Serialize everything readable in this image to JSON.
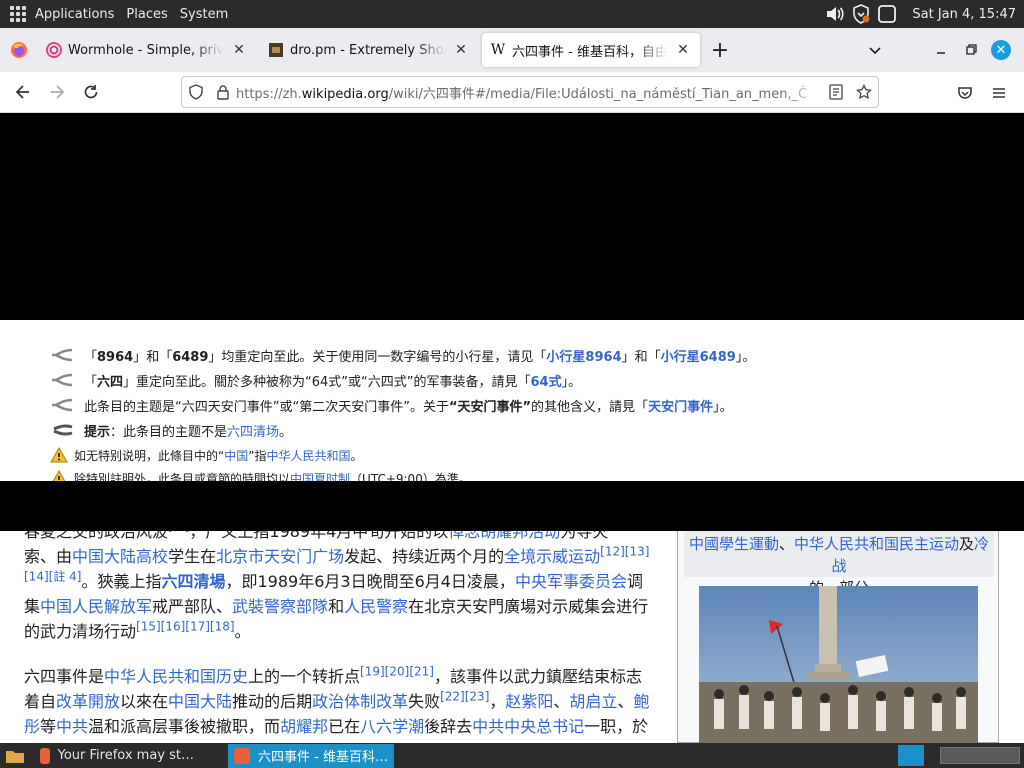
{
  "panel": {
    "applications": "Applications",
    "places": "Places",
    "system": "System",
    "clock": "Sat Jan  4, 15:47"
  },
  "tabs": [
    {
      "title": "Wormhole - Simple, private",
      "favicon": "wormhole-icon"
    },
    {
      "title": "dro.pm - Extremely Short Li",
      "favicon": "dropm-icon"
    },
    {
      "title": "六四事件 - 维基百科，自由的",
      "favicon": "wikipedia-icon",
      "active": true
    }
  ],
  "urlbar": {
    "prefix": "https://zh.",
    "host": "wikipedia.org",
    "path": "/wiki/六四事件#/media/File:Události_na_náměstí_Tian_an_men,_Č"
  },
  "notices": [
    {
      "icon": "redirect-icon",
      "parts": [
        {
          "t": "「"
        },
        {
          "t": "8964",
          "b": true
        },
        {
          "t": "」和「"
        },
        {
          "t": "6489",
          "b": true
        },
        {
          "t": "」均重定向至此。关于使用同一数字编号的小行星，请见「"
        },
        {
          "t": "小行星8964",
          "link": true,
          "b": true
        },
        {
          "t": "」和「"
        },
        {
          "t": "小行星6489",
          "link": true,
          "b": true
        },
        {
          "t": "」。"
        }
      ]
    },
    {
      "icon": "redirect-icon",
      "parts": [
        {
          "t": "「"
        },
        {
          "t": "六四",
          "b": true
        },
        {
          "t": "」重定向至此。關於多种被称为“64式”或“六四式”的军事装备，請見「"
        },
        {
          "t": "64式",
          "link": true,
          "b": true
        },
        {
          "t": "」。"
        }
      ]
    },
    {
      "icon": "redirect-icon",
      "parts": [
        {
          "t": "此条目的主题是“六四天安门事件”或“第二次天安门事件”。关于"
        },
        {
          "t": "“天安门事件”",
          "b": true
        },
        {
          "t": "的其他含义，請見「"
        },
        {
          "t": "天安门事件",
          "link": true,
          "b": true
        },
        {
          "t": "」。"
        }
      ]
    },
    {
      "icon": "hint-icon",
      "parts": [
        {
          "t": "提示",
          "b": true
        },
        {
          "t": "：此条目的主题不是"
        },
        {
          "t": "六四清场",
          "link": true
        },
        {
          "t": "。"
        }
      ]
    },
    {
      "icon": "warning-icon",
      "parts": [
        {
          "t": "如无特别说明，此條目中的“"
        },
        {
          "t": "中国",
          "link": true
        },
        {
          "t": "”指"
        },
        {
          "t": "中华人民共和国",
          "link": true
        },
        {
          "t": "。"
        }
      ]
    },
    {
      "icon": "warning-icon",
      "parts": [
        {
          "t": "除特別註明外，此条目或章節的時間均以"
        },
        {
          "t": "中国夏时制",
          "link": true
        },
        {
          "t": "（UTC+9:00）為準。"
        }
      ]
    }
  ],
  "article": {
    "para1": [
      {
        "t": "春夏之交的政治风波"
      },
      {
        "t": "[…]",
        "sup": true
      },
      {
        "t": "，广义上指1989年4月中旬开始的以"
      },
      {
        "t": "悼念胡耀邦活动",
        "link": true
      },
      {
        "t": "为导火"
      },
      {
        "br": true
      },
      {
        "t": "索、由"
      },
      {
        "t": "中国",
        "link": true
      },
      {
        "t": "大陆",
        "link": true
      },
      {
        "t": "高校",
        "link": true
      },
      {
        "t": "学生在"
      },
      {
        "t": "北京市",
        "link": true
      },
      {
        "t": "天安门广场",
        "link": true
      },
      {
        "t": "发起、持续近两个月的"
      },
      {
        "t": "全境示威运动",
        "link": true
      },
      {
        "t": "[12][13]",
        "sup": true
      },
      {
        "br": true
      },
      {
        "t": "[14][註 4]",
        "sup": true
      },
      {
        "t": "。狹義上指"
      },
      {
        "t": "六四清場",
        "link": true,
        "b": true
      },
      {
        "t": "，即1989年6月3日晚間至6月4日凌晨，"
      },
      {
        "t": "中央军事委员会",
        "link": true
      },
      {
        "t": "调"
      },
      {
        "br": true
      },
      {
        "t": "集"
      },
      {
        "t": "中国人民解放军",
        "link": true
      },
      {
        "t": "戒严部队、"
      },
      {
        "t": "武裝警察部隊",
        "link": true
      },
      {
        "t": "和"
      },
      {
        "t": "人民警察",
        "link": true
      },
      {
        "t": "在北京天安門廣場对示威集会进行"
      },
      {
        "br": true
      },
      {
        "t": "的武力清场行动"
      },
      {
        "t": "[15][16][17][18]",
        "sup": true
      },
      {
        "t": "。"
      }
    ],
    "para2": [
      {
        "t": "六四事件是"
      },
      {
        "t": "中华人民共和国历史",
        "link": true
      },
      {
        "t": "上的一个转折点"
      },
      {
        "t": "[19][20][21]",
        "sup": true
      },
      {
        "t": "，該事件以武力鎮壓结束标志"
      },
      {
        "br": true
      },
      {
        "t": "着自"
      },
      {
        "t": "改革開放",
        "link": true
      },
      {
        "t": "以來在"
      },
      {
        "t": "中国大陆",
        "link": true
      },
      {
        "t": "推动的后期"
      },
      {
        "t": "政治体制改革",
        "link": true
      },
      {
        "t": "失败"
      },
      {
        "t": "[22][23]",
        "sup": true
      },
      {
        "t": "，"
      },
      {
        "t": "赵紫阳",
        "link": true
      },
      {
        "t": "、"
      },
      {
        "t": "胡启立",
        "link": true
      },
      {
        "t": "、"
      },
      {
        "t": "鲍",
        "link": true
      },
      {
        "br": true
      },
      {
        "t": "彤",
        "link": true
      },
      {
        "t": "等"
      },
      {
        "t": "中共",
        "link": true
      },
      {
        "t": "温和派高层事後被撤职，而"
      },
      {
        "t": "胡耀邦",
        "link": true
      },
      {
        "t": "已在"
      },
      {
        "t": "八六学潮",
        "link": true
      },
      {
        "t": "後辞去"
      },
      {
        "t": "中共中央总书记",
        "link": true
      },
      {
        "t": "一职，於"
      }
    ],
    "infobox_caption": [
      {
        "t": "中國學生運動",
        "link": true
      },
      {
        "t": "、"
      },
      {
        "t": "中华人民共和国民主运动",
        "link": true
      },
      {
        "t": "及"
      },
      {
        "t": "冷战",
        "link": true
      },
      {
        "br": true
      },
      {
        "t": "的一部分"
      }
    ]
  },
  "taskbar": {
    "items": [
      {
        "label": "Your Firefox may st…",
        "active": false
      },
      {
        "label": "六四事件 - 维基百科…",
        "active": true
      }
    ]
  },
  "colors": {
    "link": "#3366cc",
    "panel": "#2b2b2b",
    "taskbar_active": "#1e90c8",
    "tabstrip": "#ecebf0"
  }
}
